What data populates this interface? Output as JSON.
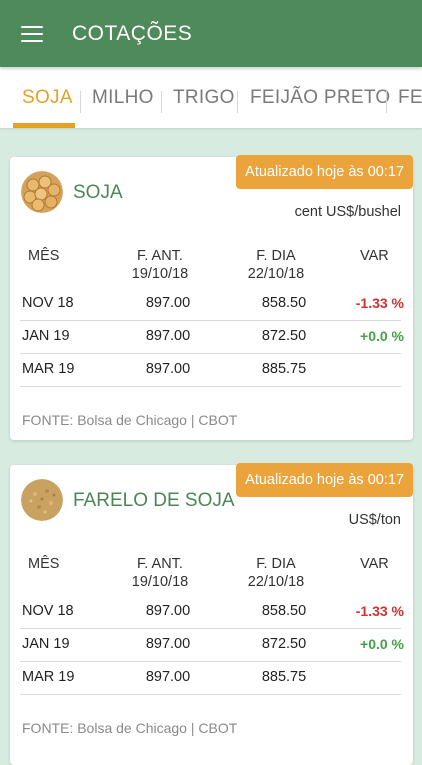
{
  "app": {
    "title": "COTAÇÕES",
    "menu_icon": "menu-icon"
  },
  "tabs": [
    {
      "label": "SOJA",
      "active": true
    },
    {
      "label": "MILHO",
      "active": false
    },
    {
      "label": "TRIGO",
      "active": false
    },
    {
      "label": "FEIJÃO PRETO",
      "active": false
    },
    {
      "label": "FEI",
      "active": false
    }
  ],
  "colors": {
    "appbar": "#4e8a5a",
    "accent": "#e3a226",
    "badge": "#eba43b",
    "negative": "#d32f2f",
    "positive": "#43a047"
  },
  "cards": [
    {
      "title": "SOJA",
      "icon": "soybean-icon",
      "badge": "Atualizado hoje às 00:17",
      "unit": "cent US$/bushel",
      "headers": {
        "mes": "MÊS",
        "ant": "F. ANT.",
        "ant_date": "19/10/18",
        "dia": "F. DIA",
        "dia_date": "22/10/18",
        "var": "VAR"
      },
      "rows": [
        {
          "mes": "NOV 18",
          "ant": "897.00",
          "dia": "858.50",
          "var": "-1.33 %"
        },
        {
          "mes": "JAN 19",
          "ant": "897.00",
          "dia": "872.50",
          "var": "+0.0 %"
        },
        {
          "mes": "MAR 19",
          "ant": "897.00",
          "dia": "885.75",
          "var": ""
        }
      ],
      "source": "FONTE: Bolsa de Chicago | CBOT"
    },
    {
      "title": "FARELO DE SOJA",
      "icon": "soybean-meal-icon",
      "badge": "Atualizado hoje às 00:17",
      "unit": "US$/ton",
      "headers": {
        "mes": "MÊS",
        "ant": "F. ANT.",
        "ant_date": "19/10/18",
        "dia": "F. DIA",
        "dia_date": "22/10/18",
        "var": "VAR"
      },
      "rows": [
        {
          "mes": "NOV 18",
          "ant": "897.00",
          "dia": "858.50",
          "var": "-1.33 %"
        },
        {
          "mes": "JAN 19",
          "ant": "897.00",
          "dia": "872.50",
          "var": "+0.0 %"
        },
        {
          "mes": "MAR 19",
          "ant": "897.00",
          "dia": "885.75",
          "var": ""
        }
      ],
      "source": "FONTE: Bolsa de Chicago | CBOT"
    }
  ]
}
